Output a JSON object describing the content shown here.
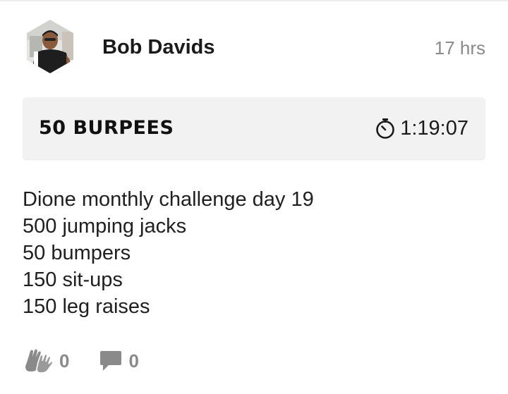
{
  "post": {
    "author_name": "Bob Davids",
    "time_ago": "17 hrs",
    "workout": {
      "title": "50 BURPEES",
      "duration": "1:19:07"
    },
    "description_lines": [
      "Dione monthly challenge day 19",
      "500 jumping jacks",
      "50 bumpers",
      "150 sit-ups",
      "150 leg raises"
    ],
    "actions": {
      "high_five": {
        "icon": "high-five-icon",
        "count": "0"
      },
      "comment": {
        "icon": "comment-icon",
        "count": "0"
      }
    }
  },
  "colors": {
    "card_background": "#f2f2f2",
    "muted_text": "#8a8a8a",
    "icon_gray": "#8a8a8a",
    "primary_text": "#1a1a1a"
  }
}
